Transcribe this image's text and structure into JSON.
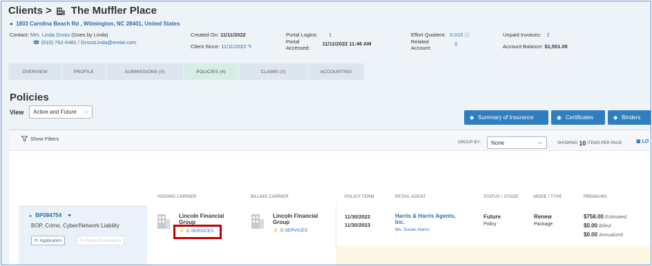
{
  "header": {
    "crumb": "Clients",
    "client_name": "The Muffler Place",
    "address": "1803 Carolina Beach Rd , Wilmington, NC 28401, United States",
    "contact_label": "Contact:",
    "contact_name": "Mrs. Linda Gross",
    "contact_aka": "(Goes by Linda)",
    "contact_phone_email": "(910) 762-6481 / GrossLinda@emial.com",
    "created_on_label": "Created On:",
    "created_on": "11/11/2022",
    "client_since_label": "Client Since:",
    "client_since": "11/11/2022",
    "portal_logins_label": "Portal Logins:",
    "portal_logins": "1",
    "portal_accessed_label_1": "Portal",
    "portal_accessed_label_2": "Accessed:",
    "portal_accessed": "11/11/2022 11:46 AM",
    "effort_label": "Effort Quotient:",
    "effort_value": "0.015",
    "related_label_1": "Related",
    "related_label_2": "Account:",
    "related_value": "0",
    "unpaid_label": "Unpaid Invoices:",
    "unpaid_value": "2",
    "balance_label": "Account Balance:",
    "balance_value": "$1,551.00"
  },
  "tabs": [
    {
      "label": "OVERVIEW"
    },
    {
      "label": "PROFILE"
    },
    {
      "label": "SUBMISSIONS (0)"
    },
    {
      "label": "POLICIES (4)"
    },
    {
      "label": "CLAIMS (0)"
    },
    {
      "label": "ACCOUNTING"
    }
  ],
  "policies": {
    "title": "Policies",
    "view_label": "View",
    "view_value": "Active and Future",
    "buttons": {
      "summary": "Summary of Insurance",
      "certificates": "Certificates",
      "binders": "Binders"
    },
    "show_filters": "Show Filters",
    "group_by_label": "GROUP BY:",
    "group_by_value": "None",
    "showing_label": "SHOWING",
    "showing_count": "10",
    "items_per_page": "ITEMS PER PAGE",
    "lock_label": "LO"
  },
  "columns": {
    "issuing": "ISSUING CARRIER",
    "billing": "BILLING CARRIER",
    "term": "POLICY TERM",
    "agent": "RETAIL AGENT",
    "status": "STATUS / STAGE",
    "mode": "MODE / TYPE",
    "premiums": "PREMIUMS"
  },
  "row": {
    "policy_id": "BP084754",
    "lines": "BOP, Crime, Cyber/Network Liability",
    "application_btn": "Application",
    "policy_docs_btn": "Policy Documents",
    "issuing_carrier_1": "Lincoln Financial",
    "issuing_carrier_2": "Group",
    "issuing_eservices": "E-SERVICES",
    "billing_carrier_1": "Lincoln Financial",
    "billing_carrier_2": "Group",
    "billing_eservices": "E-SERVICES",
    "term_start": "11/30/2022",
    "term_end": "11/30/2023",
    "agent_1": "Harris & Harris Agents,",
    "agent_2": "Inc.",
    "agent_contact": "Ms. Susan Harris",
    "status": "Future",
    "stage": "Policy",
    "mode": "Renew",
    "type": "Package",
    "premium_est": "$758.00",
    "premium_est_label": "Estimated",
    "premium_billed": "$0.00",
    "premium_billed_label": "Billed",
    "premium_ann": "$0.00",
    "premium_ann_label": "Annualized"
  }
}
